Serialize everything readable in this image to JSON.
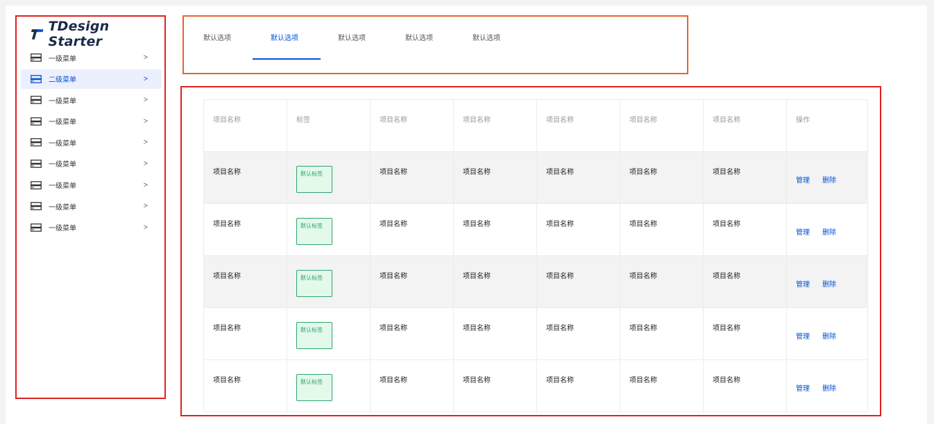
{
  "logo": {
    "text": "TDesign Starter",
    "icon": "tdesign-logo-icon",
    "brand_color": "#0052d9"
  },
  "sidebar": {
    "items": [
      {
        "label": "一级菜单",
        "active": false
      },
      {
        "label": "二级菜单",
        "active": true
      },
      {
        "label": "一级菜单",
        "active": false
      },
      {
        "label": "一级菜单",
        "active": false
      },
      {
        "label": "一级菜单",
        "active": false
      },
      {
        "label": "一级菜单",
        "active": false
      },
      {
        "label": "一级菜单",
        "active": false
      },
      {
        "label": "一级菜单",
        "active": false
      },
      {
        "label": "一级菜单",
        "active": false
      }
    ],
    "item_icon": "server-icon",
    "arrow": ">"
  },
  "tabs": [
    {
      "label": "默认选项",
      "active": false
    },
    {
      "label": "默认选项",
      "active": true
    },
    {
      "label": "默认选项",
      "active": false
    },
    {
      "label": "默认选项",
      "active": false
    },
    {
      "label": "默认选项",
      "active": false
    }
  ],
  "table": {
    "headers": [
      "项目名称",
      "标签",
      "项目名称",
      "项目名称",
      "项目名称",
      "项目名称",
      "项目名称",
      "操作"
    ],
    "rows": [
      {
        "cells": [
          "项目名称",
          "默认标签",
          "项目名称",
          "项目名称",
          "项目名称",
          "项目名称",
          "项目名称"
        ],
        "shaded": true
      },
      {
        "cells": [
          "项目名称",
          "默认标签",
          "项目名称",
          "项目名称",
          "项目名称",
          "项目名称",
          "项目名称"
        ],
        "shaded": false
      },
      {
        "cells": [
          "项目名称",
          "默认标签",
          "项目名称",
          "项目名称",
          "项目名称",
          "项目名称",
          "项目名称"
        ],
        "shaded": true
      },
      {
        "cells": [
          "项目名称",
          "默认标签",
          "项目名称",
          "项目名称",
          "项目名称",
          "项目名称",
          "项目名称"
        ],
        "shaded": false
      },
      {
        "cells": [
          "项目名称",
          "默认标签",
          "项目名称",
          "项目名称",
          "项目名称",
          "项目名称",
          "项目名称"
        ],
        "shaded": false
      }
    ],
    "actions": {
      "manage": "管理",
      "delete": "删除"
    }
  },
  "colors": {
    "accent": "#0052d9",
    "tag_green": "#2ba471",
    "highlight_red": "#e02020",
    "highlight_orange": "#e8622d"
  }
}
